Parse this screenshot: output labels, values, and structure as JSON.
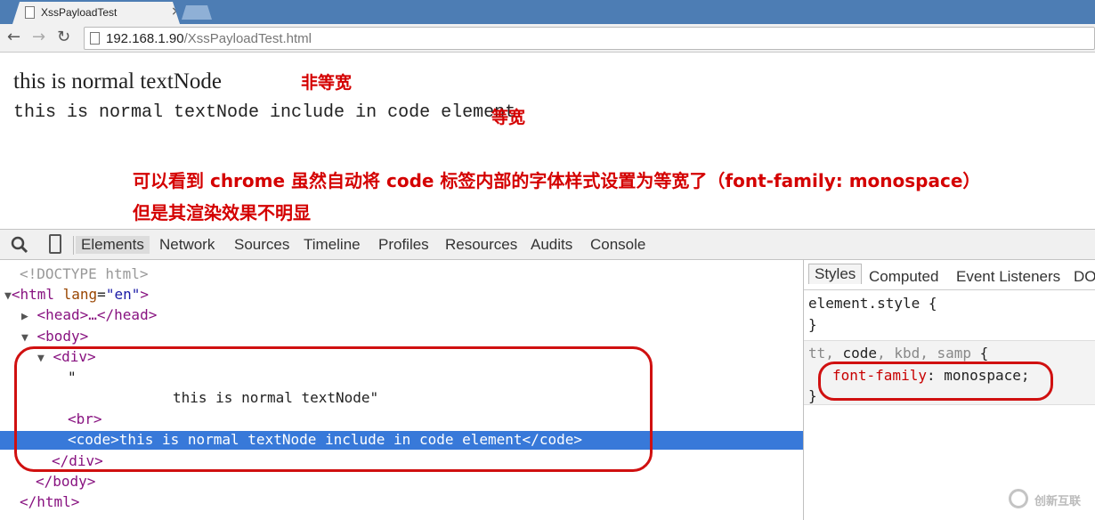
{
  "browser": {
    "tab_title": "XssPayloadTest",
    "tab_close": "×",
    "url_host": "192.168.1.90",
    "url_path": "/XssPayloadTest.html",
    "back": "←",
    "forward": "→",
    "reload": "↻"
  },
  "page": {
    "line1_text": "this is normal textNode",
    "line1_note": "非等宽",
    "line2_text": "this is normal textNode include in code element",
    "line2_note": "等宽",
    "note_line1": "可以看到 chrome 虽然自动将 code 标签内部的字体样式设置为等宽了（font-family: monospace）",
    "note_line2": "但是其渲染效果不明显"
  },
  "devtools": {
    "tabs": [
      "Elements",
      "Network",
      "Sources",
      "Timeline",
      "Profiles",
      "Resources",
      "Audits",
      "Console"
    ],
    "dom": {
      "doctype": "<!DOCTYPE html>",
      "html_open": "<html",
      "html_attr": "lang",
      "html_attr_val": "\"en\"",
      "head": "<head>…</head>",
      "body_open": "<body>",
      "div_open": "<div>",
      "text_quote": "\"",
      "text_node": "this is normal textNode\"",
      "br": "<br>",
      "code_open": "<code>",
      "code_text": "this is normal textNode include in code element",
      "code_close": "</code>",
      "div_close": "</div>",
      "body_close": "</body>",
      "html_close": "</html>"
    },
    "styles": {
      "tabs": [
        "Styles",
        "Computed",
        "Event Listeners",
        "DO"
      ],
      "element_style": "element.style {",
      "close_brace": "}",
      "selector_tt": "tt",
      "selector_code": "code",
      "selector_kbd": "kbd",
      "selector_samp": "samp",
      "rule_prop": "font-family",
      "rule_value": "monospace;"
    }
  },
  "watermark": "创新互联"
}
